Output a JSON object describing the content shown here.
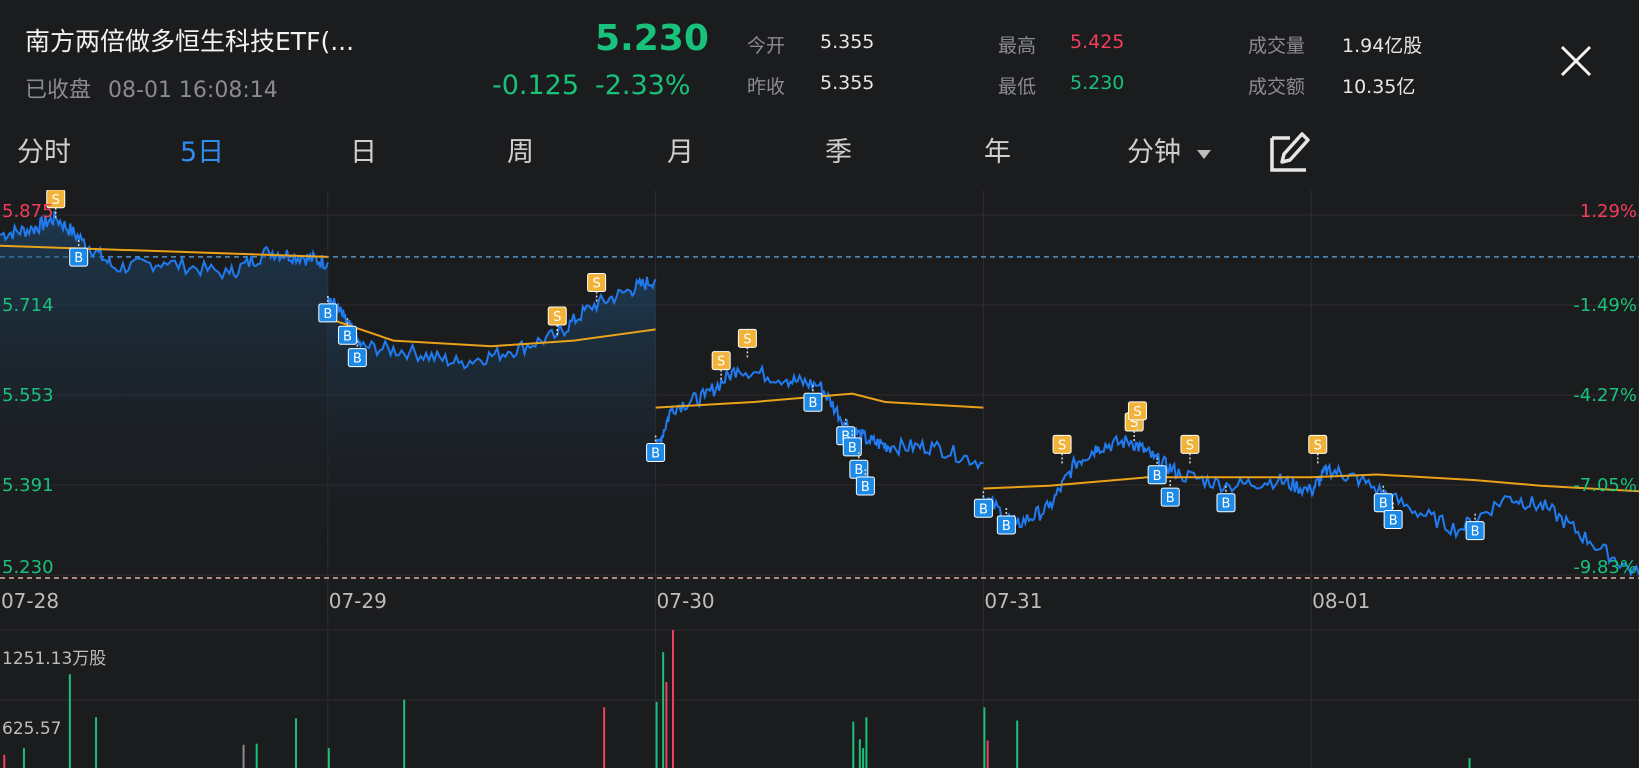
{
  "header": {
    "title": "南方两倍做多恒生科技ETF(...",
    "status": "已收盘",
    "datetime": "08-01 16:08:14",
    "price": "5.230",
    "change": "-0.125",
    "change_pct": "-2.33%"
  },
  "stats": {
    "open_label": "今开",
    "open_value": "5.355",
    "prev_label": "昨收",
    "prev_value": "5.355",
    "high_label": "最高",
    "high_value": "5.425",
    "low_label": "最低",
    "low_value": "5.230",
    "volume_label": "成交量",
    "volume_value": "1.94亿股",
    "amount_label": "成交额",
    "amount_value": "10.35亿"
  },
  "tabs": [
    "分时",
    "5日",
    "日",
    "周",
    "月",
    "季",
    "年",
    "分钟"
  ],
  "active_tab": "5日",
  "icons": {
    "close": "close-icon",
    "dropdown": "chevron-down-icon",
    "draw": "draw-tool-icon"
  },
  "colors": {
    "up": "#f23d5c",
    "down": "#19c27a",
    "price_line": "#1f7bef",
    "avg_line": "#e9a21a",
    "accent": "#2f8cf0",
    "buy_marker": "#1c8ae6",
    "sell_marker": "#f2b33a"
  },
  "chart_data": {
    "type": "line",
    "x": [
      "07-28",
      "07-29",
      "07-30",
      "07-31",
      "08-01"
    ],
    "y_ticks": [
      "5.875",
      "5.714",
      "5.553",
      "5.391",
      "5.230"
    ],
    "pct_ticks": [
      "1.29%",
      "-1.49%",
      "-4.27%",
      "-7.05%",
      "-9.83%"
    ],
    "ylim": [
      5.23,
      5.875
    ],
    "reference_price": 5.8,
    "series": [
      {
        "values": [
          [
            0,
            5.84
          ],
          [
            0.1,
            5.85
          ],
          [
            0.17,
            5.87
          ],
          [
            0.25,
            5.83
          ],
          [
            0.35,
            5.78
          ],
          [
            0.5,
            5.79
          ],
          [
            0.7,
            5.77
          ],
          [
            0.82,
            5.81
          ],
          [
            0.92,
            5.8
          ],
          [
            1.0,
            5.79
          ],
          [
            1.0,
            5.73
          ],
          [
            1.05,
            5.69
          ],
          [
            1.1,
            5.64
          ],
          [
            1.25,
            5.63
          ],
          [
            1.4,
            5.61
          ],
          [
            1.55,
            5.63
          ],
          [
            1.7,
            5.66
          ],
          [
            1.8,
            5.71
          ],
          [
            1.92,
            5.74
          ],
          [
            2.0,
            5.76
          ],
          [
            2.0,
            5.45
          ],
          [
            2.05,
            5.53
          ],
          [
            2.15,
            5.55
          ],
          [
            2.25,
            5.6
          ],
          [
            2.4,
            5.58
          ],
          [
            2.5,
            5.57
          ],
          [
            2.58,
            5.5
          ],
          [
            2.65,
            5.47
          ],
          [
            2.72,
            5.46
          ],
          [
            2.85,
            5.46
          ],
          [
            3.0,
            5.43
          ],
          [
            3.0,
            5.37
          ],
          [
            3.1,
            5.32
          ],
          [
            3.2,
            5.35
          ],
          [
            3.28,
            5.43
          ],
          [
            3.35,
            5.46
          ],
          [
            3.45,
            5.47
          ],
          [
            3.52,
            5.44
          ],
          [
            3.6,
            5.41
          ],
          [
            3.75,
            5.39
          ],
          [
            3.9,
            5.4
          ],
          [
            4.0,
            5.38
          ],
          [
            4.05,
            5.42
          ],
          [
            4.15,
            5.4
          ],
          [
            4.3,
            5.35
          ],
          [
            4.45,
            5.31
          ],
          [
            4.6,
            5.37
          ],
          [
            4.72,
            5.35
          ],
          [
            4.85,
            5.29
          ],
          [
            5.0,
            5.23
          ]
        ]
      },
      {
        "values": [
          [
            0,
            5.82
          ],
          [
            0.5,
            5.81
          ],
          [
            1.0,
            5.8
          ],
          [
            1.0,
            5.69
          ],
          [
            1.2,
            5.65
          ],
          [
            1.5,
            5.64
          ],
          [
            1.75,
            5.65
          ],
          [
            2.0,
            5.67
          ],
          [
            2.0,
            5.53
          ],
          [
            2.3,
            5.54
          ],
          [
            2.6,
            5.555
          ],
          [
            2.7,
            5.54
          ],
          [
            3.0,
            5.53
          ],
          [
            3.0,
            5.385
          ],
          [
            3.2,
            5.39
          ],
          [
            3.5,
            5.405
          ],
          [
            4.0,
            5.405
          ],
          [
            4.2,
            5.41
          ],
          [
            4.5,
            5.4
          ],
          [
            4.7,
            5.39
          ],
          [
            5.0,
            5.38
          ]
        ]
      }
    ],
    "markers": [
      {
        "type": "S",
        "x": 0.17,
        "y": 5.87
      },
      {
        "type": "B",
        "x": 0.24,
        "y": 5.83
      },
      {
        "type": "B",
        "x": 1.0,
        "y": 5.73
      },
      {
        "type": "B",
        "x": 1.06,
        "y": 5.69
      },
      {
        "type": "B",
        "x": 1.09,
        "y": 5.65
      },
      {
        "type": "S",
        "x": 1.7,
        "y": 5.66
      },
      {
        "type": "S",
        "x": 1.82,
        "y": 5.72
      },
      {
        "type": "B",
        "x": 2.0,
        "y": 5.48
      },
      {
        "type": "S",
        "x": 2.2,
        "y": 5.58
      },
      {
        "type": "S",
        "x": 2.28,
        "y": 5.62
      },
      {
        "type": "B",
        "x": 2.48,
        "y": 5.57
      },
      {
        "type": "B",
        "x": 2.58,
        "y": 5.51
      },
      {
        "type": "B",
        "x": 2.6,
        "y": 5.49
      },
      {
        "type": "B",
        "x": 2.62,
        "y": 5.45
      },
      {
        "type": "B",
        "x": 2.64,
        "y": 5.42
      },
      {
        "type": "B",
        "x": 3.0,
        "y": 5.38
      },
      {
        "type": "B",
        "x": 3.07,
        "y": 5.35
      },
      {
        "type": "S",
        "x": 3.24,
        "y": 5.43
      },
      {
        "type": "S",
        "x": 3.46,
        "y": 5.47
      },
      {
        "type": "S",
        "x": 3.47,
        "y": 5.49
      },
      {
        "type": "B",
        "x": 3.53,
        "y": 5.44
      },
      {
        "type": "S",
        "x": 3.63,
        "y": 5.43
      },
      {
        "type": "B",
        "x": 3.57,
        "y": 5.4
      },
      {
        "type": "B",
        "x": 3.74,
        "y": 5.39
      },
      {
        "type": "S",
        "x": 4.02,
        "y": 5.43
      },
      {
        "type": "B",
        "x": 4.22,
        "y": 5.39
      },
      {
        "type": "B",
        "x": 4.25,
        "y": 5.36
      },
      {
        "type": "B",
        "x": 4.5,
        "y": 5.34
      }
    ],
    "volume": {
      "unit": "万股",
      "y_ticks": [
        "1251.13万股",
        "625.57"
      ],
      "max": 1251.13,
      "bars": [
        {
          "x": 0.01,
          "v": 120,
          "c": "red"
        },
        {
          "x": 0.07,
          "v": 180,
          "c": "green"
        },
        {
          "x": 0.21,
          "v": 850,
          "c": "green"
        },
        {
          "x": 0.29,
          "v": 460,
          "c": "green"
        },
        {
          "x": 0.74,
          "v": 210,
          "c": "grey"
        },
        {
          "x": 0.78,
          "v": 220,
          "c": "green"
        },
        {
          "x": 0.9,
          "v": 450,
          "c": "green"
        },
        {
          "x": 1.0,
          "v": 180,
          "c": "green"
        },
        {
          "x": 1.23,
          "v": 620,
          "c": "green"
        },
        {
          "x": 1.84,
          "v": 550,
          "c": "red"
        },
        {
          "x": 2.0,
          "v": 600,
          "c": "green"
        },
        {
          "x": 2.02,
          "v": 1050,
          "c": "green"
        },
        {
          "x": 2.03,
          "v": 780,
          "c": "red"
        },
        {
          "x": 2.05,
          "v": 1251,
          "c": "red"
        },
        {
          "x": 2.6,
          "v": 420,
          "c": "green"
        },
        {
          "x": 2.62,
          "v": 260,
          "c": "green"
        },
        {
          "x": 2.63,
          "v": 180,
          "c": "green"
        },
        {
          "x": 2.64,
          "v": 460,
          "c": "green"
        },
        {
          "x": 3.0,
          "v": 550,
          "c": "green"
        },
        {
          "x": 3.01,
          "v": 250,
          "c": "red"
        },
        {
          "x": 3.1,
          "v": 430,
          "c": "green"
        },
        {
          "x": 4.48,
          "v": 90,
          "c": "green"
        }
      ]
    }
  }
}
